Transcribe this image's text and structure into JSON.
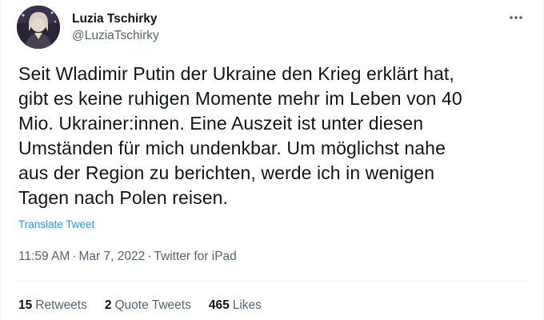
{
  "author": {
    "display_name": "Luzia Tschirky",
    "handle": "@LuziaTschirky",
    "avatar_icon": "profile-photo"
  },
  "more_icon": "more-dots-icon",
  "tweet": {
    "lines": [
      "Seit Wladimir Putin der Ukraine den Krieg erklärt hat,",
      "gibt es keine ruhigen Momente mehr im Leben von 40",
      "Mio. Ukrainer:innen. Eine Auszeit ist unter diesen",
      "Umständen für mich undenkbar. Um möglichst nahe",
      "aus der Region zu berichten, werde ich in wenigen",
      "Tagen nach Polen reisen."
    ],
    "translate_label": "Translate Tweet"
  },
  "meta": {
    "time": "11:59 AM",
    "date": "Mar 7, 2022",
    "separator": "·",
    "source": "Twitter for iPad"
  },
  "stats": {
    "retweets_count": "15",
    "retweets_label": "Retweets",
    "quote_count": "2",
    "quote_label": "Quote Tweets",
    "likes_count": "465",
    "likes_label": "Likes"
  },
  "colors": {
    "text": "#0f1419",
    "secondary": "#536471",
    "link": "#1d9bf0",
    "divider": "#eff3f4"
  }
}
